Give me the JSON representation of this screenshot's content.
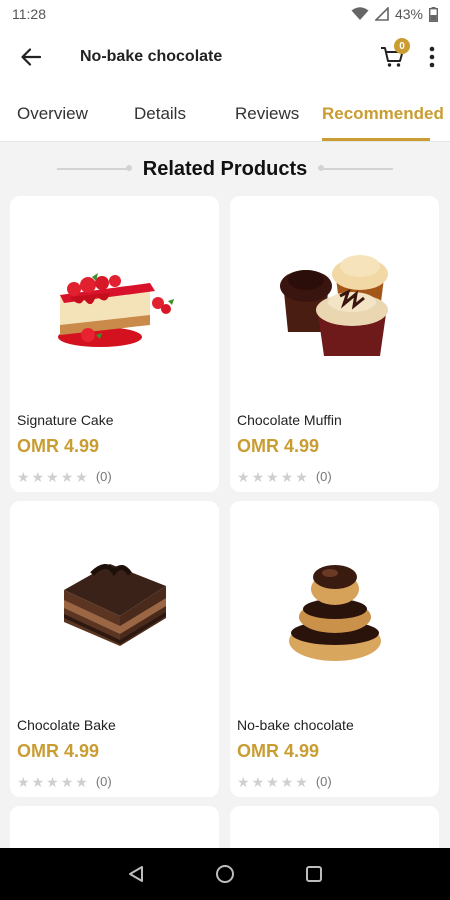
{
  "status_bar": {
    "time": "11:28",
    "battery": "43%"
  },
  "app_bar": {
    "title": "No-bake chocolate",
    "cart_count": "0"
  },
  "tabs": [
    {
      "label": "Overview"
    },
    {
      "label": "Details"
    },
    {
      "label": "Reviews"
    },
    {
      "label": "Recommended"
    }
  ],
  "section": {
    "title": "Related Products"
  },
  "products": [
    {
      "name": "Signature Cake",
      "price": "OMR 4.99",
      "rating_count": "(0)",
      "rating": 0
    },
    {
      "name": "Chocolate Muffin",
      "price": "OMR 4.99",
      "rating_count": "(0)",
      "rating": 0
    },
    {
      "name": "Chocolate Bake",
      "price": "OMR 4.99",
      "rating_count": "(0)",
      "rating": 0
    },
    {
      "name": "No-bake chocolate",
      "price": "OMR 4.99",
      "rating_count": "(0)",
      "rating": 0
    }
  ],
  "colors": {
    "accent": "#c99d32",
    "star_empty": "#cfcfcf",
    "background": "#f3f3f3"
  }
}
